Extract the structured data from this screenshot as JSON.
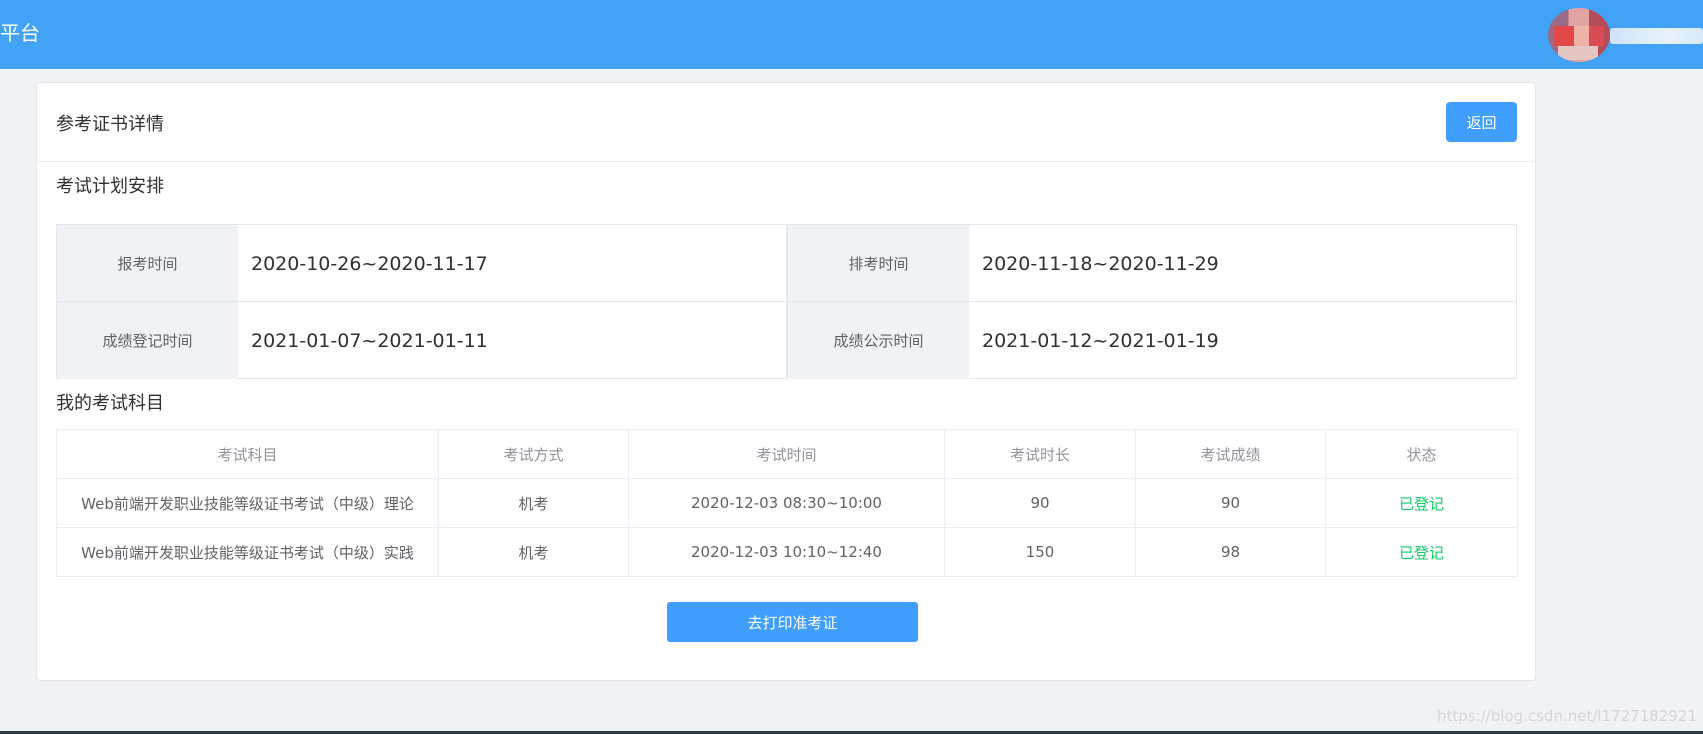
{
  "header": {
    "brand_text": "平台",
    "accent_color": "#42a3f6"
  },
  "card": {
    "title": "参考证书详情",
    "back_label": "返回"
  },
  "exam_plan": {
    "title": "考试计划安排",
    "items": [
      {
        "label": "报考时间",
        "value": "2020-10-26~2020-11-17"
      },
      {
        "label": "排考时间",
        "value": "2020-11-18~2020-11-29"
      },
      {
        "label": "成绩登记时间",
        "value": "2021-01-07~2021-01-11"
      },
      {
        "label": "成绩公示时间",
        "value": "2021-01-12~2021-01-19"
      }
    ]
  },
  "subjects": {
    "title": "我的考试科目",
    "columns": [
      "考试科目",
      "考试方式",
      "考试时间",
      "考试时长",
      "考试成绩",
      "状态"
    ],
    "rows": [
      [
        "Web前端开发职业技能等级证书考试（中级）理论",
        "机考",
        "2020-12-03 08:30~10:00",
        "90",
        "90",
        "已登记"
      ],
      [
        "Web前端开发职业技能等级证书考试（中级）实践",
        "机考",
        "2020-12-03 10:10~12:40",
        "150",
        "98",
        "已登记"
      ]
    ],
    "status_color": "#13ce66"
  },
  "print_button_label": "去打印准考证",
  "watermark": "https://blog.csdn.net/l1727182921"
}
